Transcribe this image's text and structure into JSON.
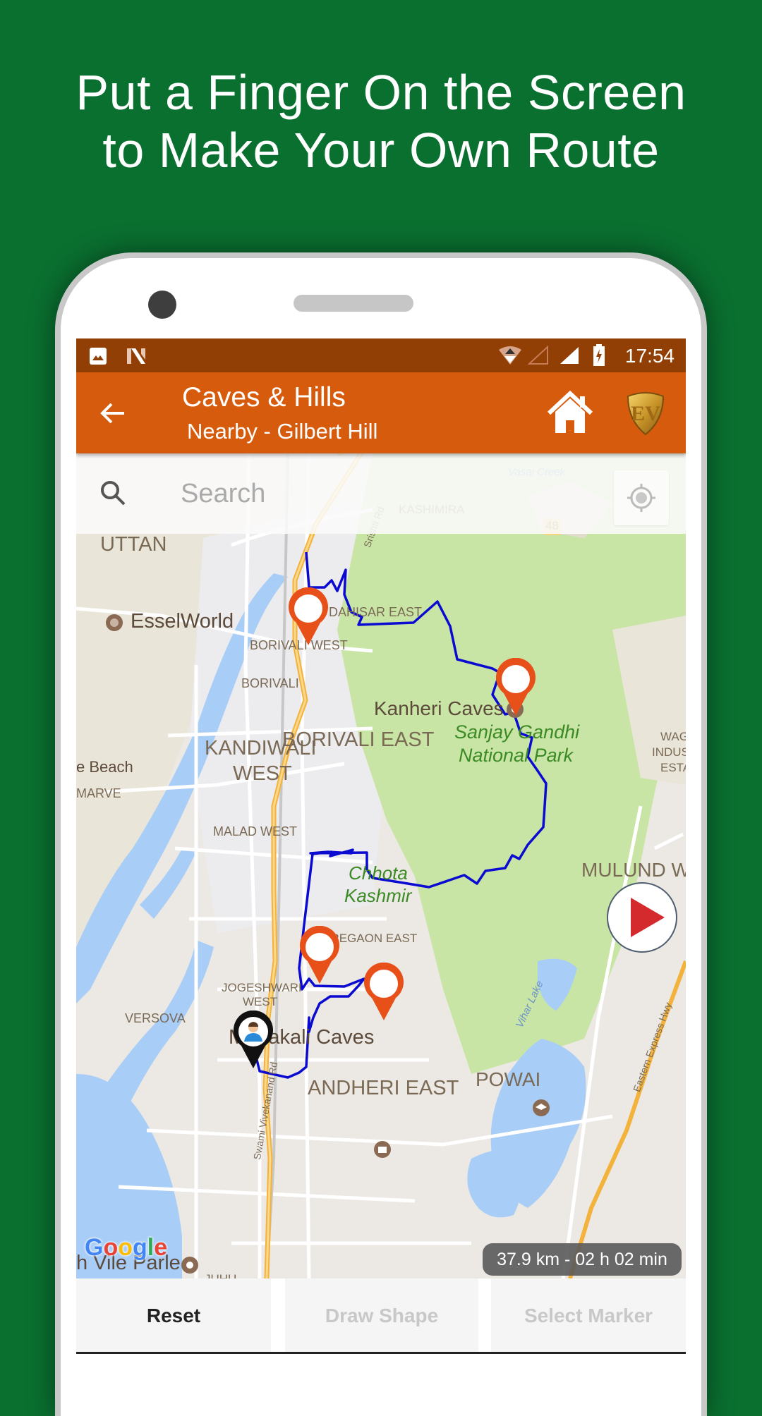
{
  "promo": {
    "line1": "Put a Finger On the Screen",
    "line2": "to Make Your Own Route"
  },
  "status_bar": {
    "time": "17:54",
    "icons": [
      "image-icon",
      "n-notification-icon",
      "wifi-icon",
      "signal-empty-icon",
      "signal-full-icon",
      "battery-charging-icon"
    ]
  },
  "app_bar": {
    "title": "Caves & Hills",
    "subtitle": "Nearby - Gilbert Hill",
    "back_icon": "arrow-left-icon",
    "home_icon": "home-icon",
    "brand_icon": "ev-shield-logo",
    "color": "#d75b0c",
    "status_color": "#913f04"
  },
  "search": {
    "placeholder": "Search",
    "value": ""
  },
  "map": {
    "labels": [
      {
        "text": "UTTAN",
        "kind": "area"
      },
      {
        "text": "DAHISAR EAST",
        "kind": "area"
      },
      {
        "text": "BORIVALI WEST",
        "kind": "area"
      },
      {
        "text": "BORIVALI",
        "kind": "area"
      },
      {
        "text": "EsselWorld",
        "kind": "poi"
      },
      {
        "text": "BORIVALI EAST",
        "kind": "area"
      },
      {
        "text": "Sanjay Gandhi",
        "kind": "park"
      },
      {
        "text": "National Park",
        "kind": "park"
      },
      {
        "text": "Kanheri Caves",
        "kind": "poi"
      },
      {
        "text": "KANDIWALI",
        "kind": "area"
      },
      {
        "text": "WEST",
        "kind": "area"
      },
      {
        "text": "e Beach",
        "kind": "poi"
      },
      {
        "text": "MARVE",
        "kind": "area"
      },
      {
        "text": "WAG",
        "kind": "area"
      },
      {
        "text": "INDUST",
        "kind": "area"
      },
      {
        "text": "ESTA",
        "kind": "area"
      },
      {
        "text": "MALAD WEST",
        "kind": "area"
      },
      {
        "text": "Chhota",
        "kind": "park"
      },
      {
        "text": "Kashmir",
        "kind": "park"
      },
      {
        "text": "MULUND W",
        "kind": "area"
      },
      {
        "text": "GOREGAON EAST",
        "kind": "area"
      },
      {
        "text": "Vihar Lake",
        "kind": "water"
      },
      {
        "text": "JOGESHWARI",
        "kind": "area"
      },
      {
        "text": "WEST",
        "kind": "area"
      },
      {
        "text": "VERSOVA",
        "kind": "area"
      },
      {
        "text": "Mahakali Caves",
        "kind": "poi"
      },
      {
        "text": "POWAI",
        "kind": "area"
      },
      {
        "text": "ANDHERI EAST",
        "kind": "area"
      },
      {
        "text": "Swami Vivekanand Rd",
        "kind": "road"
      },
      {
        "text": "Eastern Express Hwy",
        "kind": "road"
      },
      {
        "text": "h Vile Parle",
        "kind": "poi"
      },
      {
        "text": "JUHU",
        "kind": "area"
      },
      {
        "text": "KASHIMIRA",
        "kind": "area"
      },
      {
        "text": "Srishti Rd",
        "kind": "road"
      },
      {
        "text": "Vasai Creek",
        "kind": "water"
      },
      {
        "text": "48",
        "kind": "highway-shield"
      }
    ],
    "markers": [
      {
        "name": "borivali-west-marker",
        "type": "destination"
      },
      {
        "name": "kanheri-caves-marker",
        "type": "destination"
      },
      {
        "name": "jogeshwari-marker",
        "type": "destination"
      },
      {
        "name": "mahakali-caves-marker",
        "type": "destination"
      },
      {
        "name": "user-location-marker",
        "type": "current-location"
      }
    ],
    "route_color": "#0a0ad0",
    "marker_color": "#e8501a",
    "attribution": "Google"
  },
  "play_button": {
    "icon": "play-icon",
    "color": "#d42a2e"
  },
  "route_info": "37.9 km - 02 h 02 min",
  "bottom_buttons": [
    {
      "label": "Reset",
      "state": "active"
    },
    {
      "label": "Draw Shape",
      "state": "disabled"
    },
    {
      "label": "Select Marker",
      "state": "disabled"
    }
  ]
}
